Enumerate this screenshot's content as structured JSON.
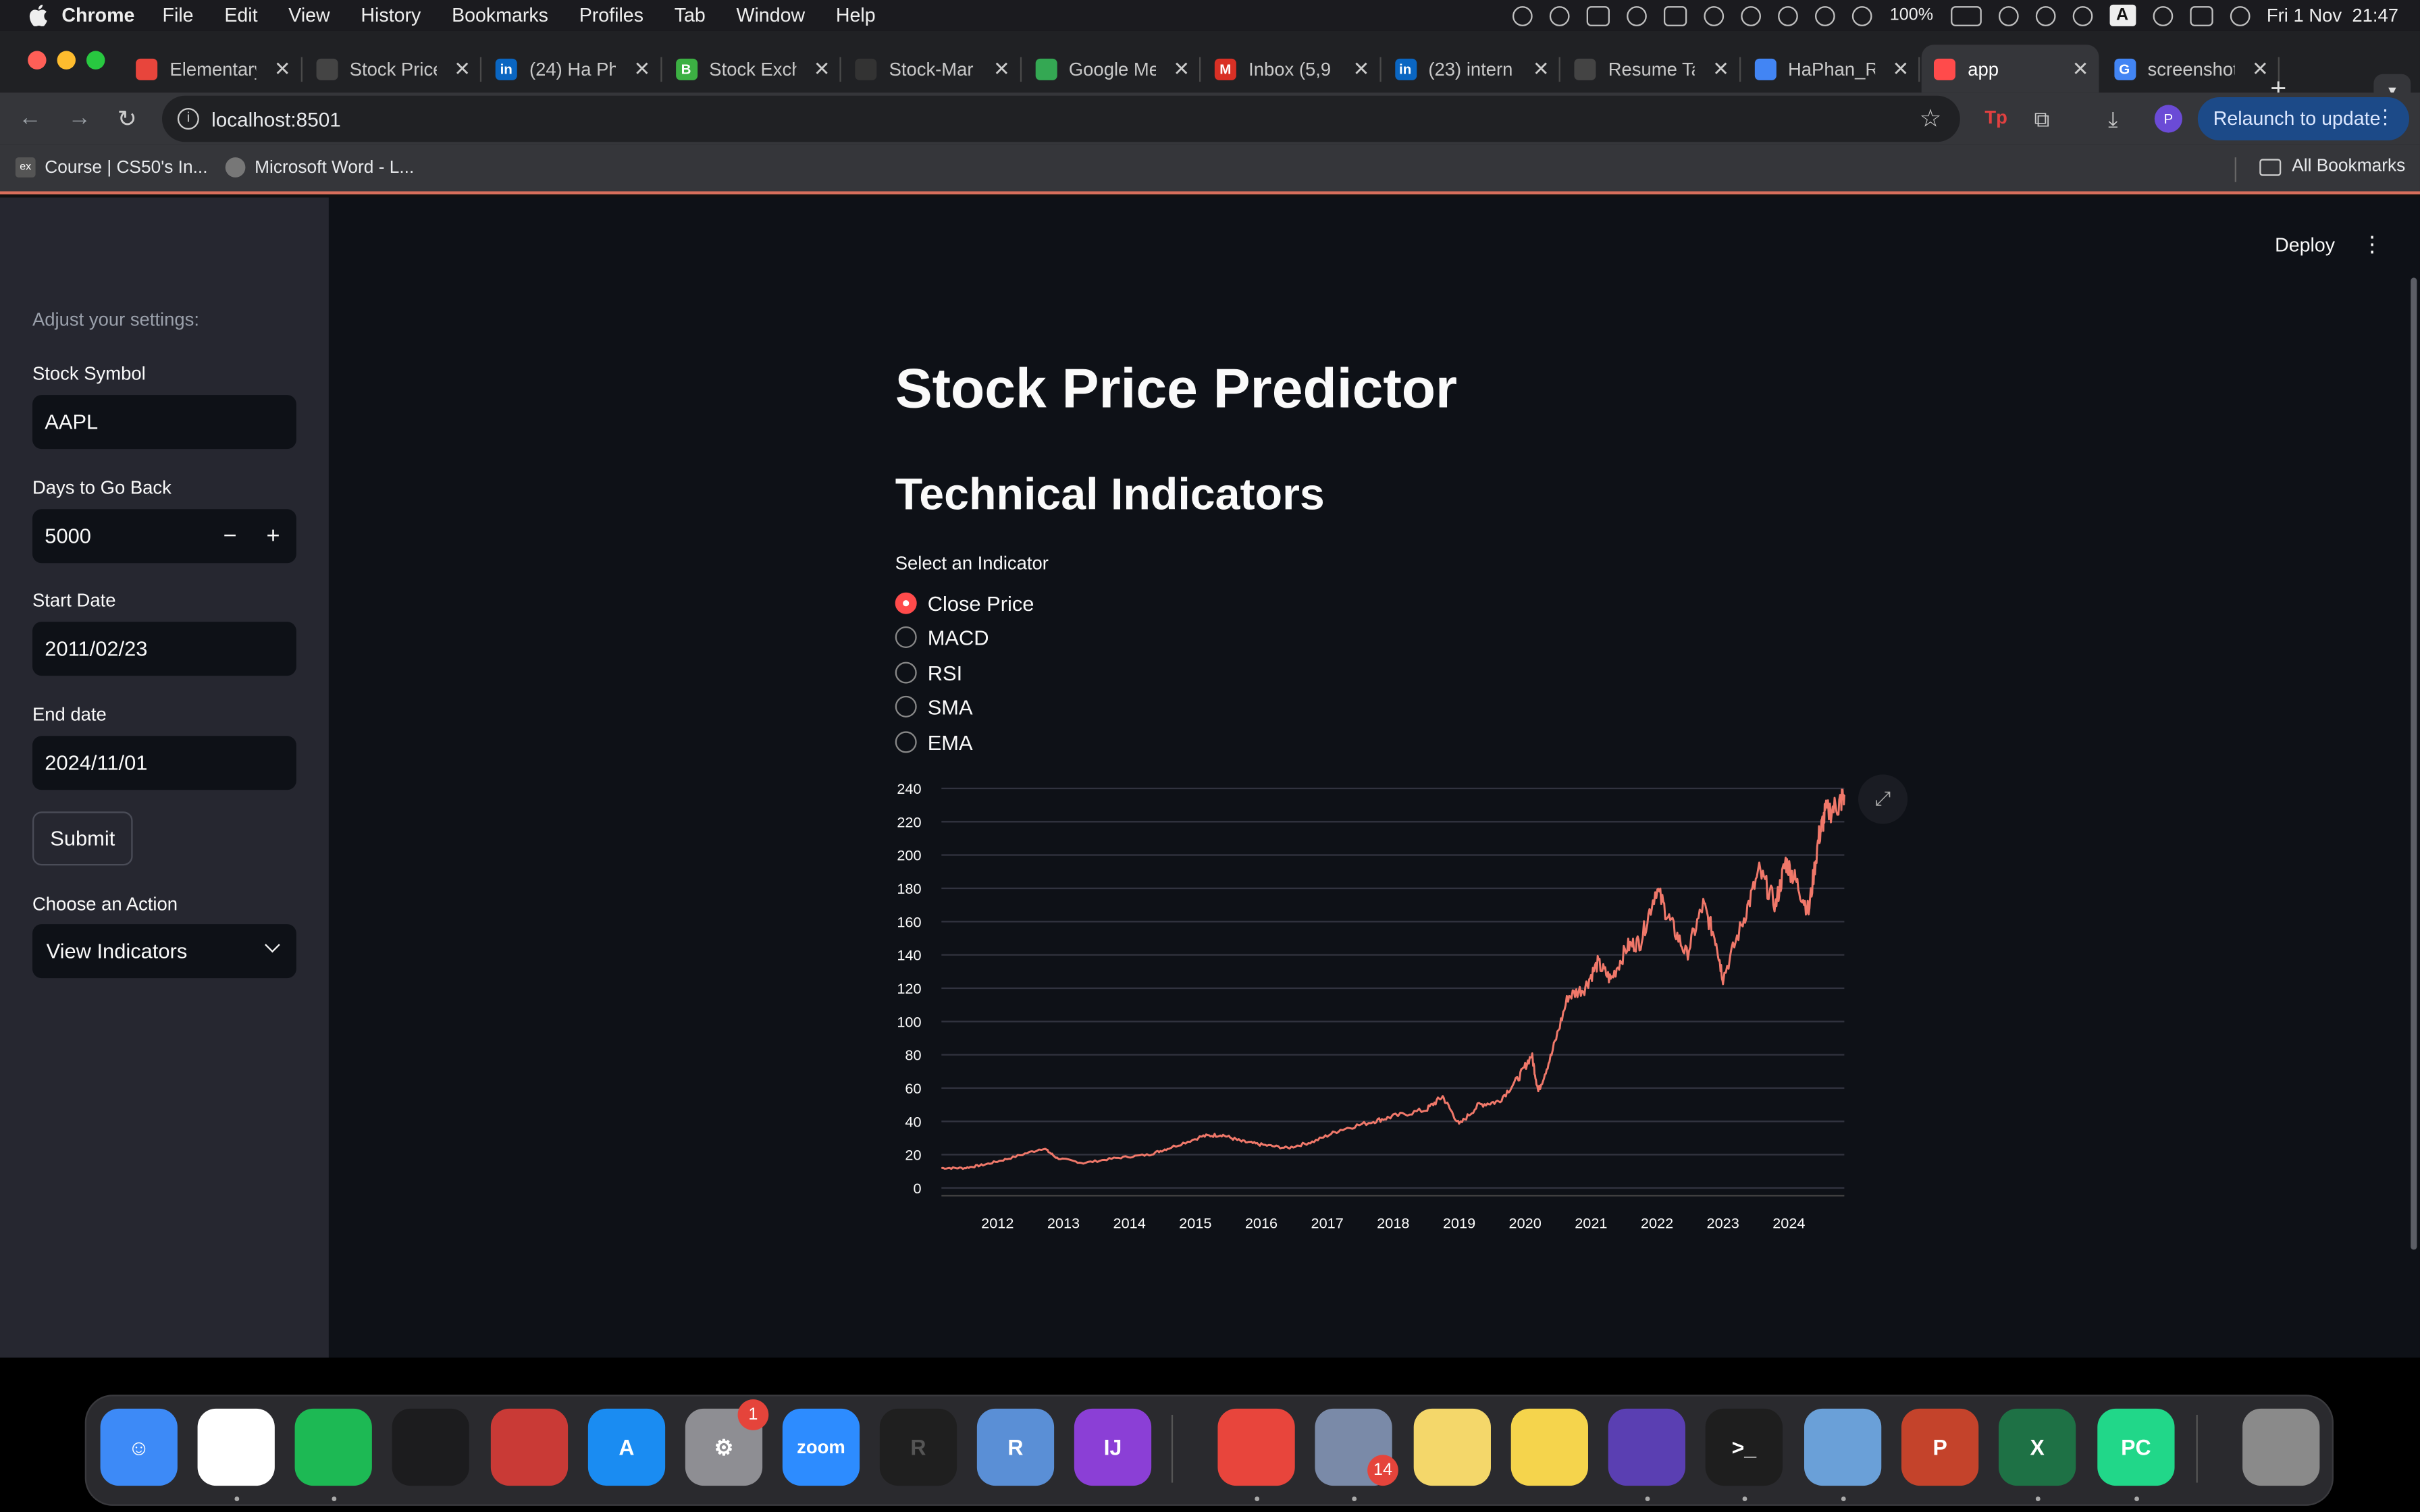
{
  "menubar": {
    "app": "Chrome",
    "items": [
      "File",
      "Edit",
      "View",
      "History",
      "Bookmarks",
      "Profiles",
      "Tab",
      "Window",
      "Help"
    ],
    "battery": "100%",
    "datetime": "Fri 1 Nov  21:47",
    "input_indicator": "A"
  },
  "tabs": [
    {
      "label": "Elementary",
      "color": "#e8453c"
    },
    {
      "label": "Stock Price",
      "color": "#444"
    },
    {
      "label": "(24) Ha Ph",
      "color": "#0a66c2",
      "glyph": "in"
    },
    {
      "label": "Stock Exch",
      "color": "#3cb043",
      "glyph": "B"
    },
    {
      "label": "Stock-Mar",
      "color": "#333"
    },
    {
      "label": "Google Me",
      "color": "#34a853"
    },
    {
      "label": "Inbox (5,9",
      "color": "#d93025",
      "glyph": "M"
    },
    {
      "label": "(23) intern",
      "color": "#0a66c2",
      "glyph": "in"
    },
    {
      "label": "Resume Ta",
      "color": "#444"
    },
    {
      "label": "HaPhan_R",
      "color": "#4285f4"
    },
    {
      "label": "app",
      "color": "#ff4b4b",
      "active": true
    },
    {
      "label": "screenshot",
      "color": "#4285f4",
      "glyph": "G"
    }
  ],
  "toolbar": {
    "url": "localhost:8501",
    "relaunch_label": "Relaunch to update",
    "avatar_initial": "P"
  },
  "bookmarks": {
    "items": [
      "Course | CS50's In...",
      "Microsoft Word - L..."
    ],
    "all_label": "All Bookmarks"
  },
  "sidebar": {
    "caption": "Adjust your settings:",
    "symbol_label": "Stock Symbol",
    "symbol_value": "AAPL",
    "days_label": "Days to Go Back",
    "days_value": "5000",
    "start_label": "Start Date",
    "start_value": "2011/02/23",
    "end_label": "End date",
    "end_value": "2024/11/01",
    "submit_label": "Submit",
    "action_label": "Choose an Action",
    "action_value": "View Indicators"
  },
  "header": {
    "deploy_label": "Deploy"
  },
  "main": {
    "title": "Stock Price Predictor",
    "subtitle": "Technical Indicators",
    "radio_label": "Select an Indicator",
    "options": [
      "Close Price",
      "MACD",
      "RSI",
      "SMA",
      "EMA"
    ],
    "selected_index": 0
  },
  "chart_data": {
    "type": "line",
    "title": "",
    "xlabel": "",
    "ylabel": "",
    "xlim": [
      2011.15,
      2024.84
    ],
    "ylim": [
      0,
      240
    ],
    "yticks": [
      0,
      20,
      40,
      60,
      80,
      100,
      120,
      140,
      160,
      180,
      200,
      220,
      240
    ],
    "xticks": [
      "2012",
      "2013",
      "2014",
      "2015",
      "2016",
      "2017",
      "2018",
      "2019",
      "2020",
      "2021",
      "2022",
      "2023",
      "2024"
    ],
    "line_color": "#f0786a",
    "grid": true,
    "series": [
      {
        "x": [
          2011.15,
          2011.5,
          2011.8,
          2012.2,
          2012.7,
          2012.9,
          2013.3,
          2013.8,
          2014.3,
          2014.6,
          2015.1,
          2015.4,
          2015.7,
          2016.0,
          2016.4,
          2016.8,
          2017.2,
          2017.7,
          2018.0,
          2018.5,
          2018.75,
          2019.0,
          2019.3,
          2019.6,
          2019.9,
          2020.1,
          2020.2,
          2020.4,
          2020.65,
          2020.9,
          2021.1,
          2021.3,
          2021.55,
          2021.75,
          2021.99,
          2022.2,
          2022.45,
          2022.7,
          2022.9,
          2023.0,
          2023.3,
          2023.55,
          2023.8,
          2023.95,
          2024.1,
          2024.3,
          2024.45,
          2024.55,
          2024.75,
          2024.84
        ],
        "y": [
          12,
          12,
          14,
          18,
          24,
          18,
          15,
          18,
          20,
          24,
          31,
          32,
          28,
          26,
          24,
          28,
          35,
          40,
          43,
          47,
          55,
          38,
          50,
          52,
          66,
          80,
          58,
          80,
          115,
          120,
          135,
          125,
          145,
          148,
          180,
          160,
          140,
          170,
          148,
          126,
          160,
          190,
          170,
          196,
          185,
          166,
          210,
          225,
          230,
          236
        ]
      }
    ]
  },
  "dock": {
    "apps": [
      {
        "name": "finder-icon",
        "color": "#3d8af7",
        "glyph": "☺"
      },
      {
        "name": "messenger-icon",
        "color": "#ffffff",
        "glyph": ""
      },
      {
        "name": "spotify-icon",
        "color": "#1db954",
        "glyph": ""
      },
      {
        "name": "voice-memos-icon",
        "color": "#1c1c1e",
        "glyph": ""
      },
      {
        "name": "photo-booth-icon",
        "color": "#c93a36",
        "glyph": ""
      },
      {
        "name": "app-store-icon",
        "color": "#1a8cf2",
        "glyph": "A"
      },
      {
        "name": "system-settings-icon",
        "color": "#8e8e93",
        "glyph": "⚙",
        "badge": "1"
      },
      {
        "name": "zoom-icon",
        "color": "#2d8cff",
        "glyph": "zoom"
      },
      {
        "name": "r-icon",
        "color": "#1f1f1f",
        "glyph": "R"
      },
      {
        "name": "rstudio-icon",
        "color": "#5a8fd6",
        "glyph": "R"
      },
      {
        "name": "intellij-icon",
        "color": "#8b3fd6",
        "glyph": "IJ"
      },
      {
        "name": "chrome-icon",
        "color": "#e8453c",
        "glyph": ""
      },
      {
        "name": "launchpad-icon",
        "color": "#7a8aa8",
        "glyph": "",
        "badge": "14"
      },
      {
        "name": "stickies-icon",
        "color": "#f4d76a",
        "glyph": ""
      },
      {
        "name": "notes-icon",
        "color": "#f5d44c",
        "glyph": ""
      },
      {
        "name": "obsidian-icon",
        "color": "#5a3fb2",
        "glyph": ""
      },
      {
        "name": "terminal-icon",
        "color": "#1e1e1e",
        "glyph": ">_"
      },
      {
        "name": "preview-icon",
        "color": "#6aa0d8",
        "glyph": ""
      },
      {
        "name": "powerpoint-icon",
        "color": "#c4432b",
        "glyph": "P"
      },
      {
        "name": "excel-icon",
        "color": "#1e7145",
        "glyph": "X"
      },
      {
        "name": "pycharm-icon",
        "color": "#21d789",
        "glyph": "PC"
      },
      {
        "name": "trash-icon",
        "color": "#8a8a8a",
        "glyph": ""
      }
    ]
  }
}
